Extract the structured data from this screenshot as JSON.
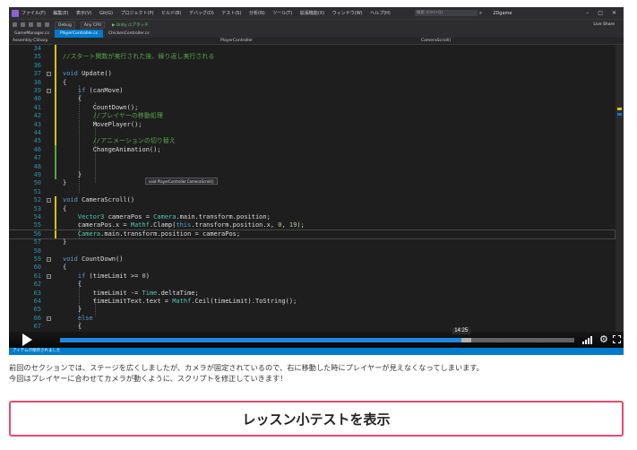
{
  "vs": {
    "menu": [
      "ファイル(F)",
      "編集(E)",
      "表示(V)",
      "Git(G)",
      "プロジェクト(P)",
      "ビルド(B)",
      "デバッグ(D)",
      "テスト(S)",
      "分析(N)",
      "ツール(T)",
      "拡張機能(X)",
      "ウィンドウ(W)",
      "ヘルプ(H)"
    ],
    "search_placeholder": "検索 (Ctrl+Q)",
    "project_name": "2Dgame",
    "toolbar": {
      "config": "Debug",
      "platform": "Any CPU",
      "run_label": "▶ Unity にアタッチ",
      "liveshare": "Live Share"
    },
    "tabs": [
      "GameManager.cs",
      "PlayerController.cs",
      "ChickenController.cs"
    ],
    "nav": {
      "assembly": "Assembly-CSharp",
      "class": "PlayerController",
      "member": "CameraScroll()"
    },
    "tooltip": "void PlayerController.CameraScroll()",
    "status": "アイテムが保存されました"
  },
  "code_lines": [
    {
      "n": "34",
      "text": ""
    },
    {
      "n": "35",
      "text": "//スタート関数が実行された後、繰り返し実行される"
    },
    {
      "n": "36",
      "text": ""
    },
    {
      "n": "37",
      "text": "void Update()"
    },
    {
      "n": "38",
      "text": "{"
    },
    {
      "n": "39",
      "text": "    if (canMove)"
    },
    {
      "n": "40",
      "text": "    {"
    },
    {
      "n": "41",
      "text": "        CountDown();"
    },
    {
      "n": "42",
      "text": "        //プレイヤーの移動処理"
    },
    {
      "n": "43",
      "text": "        MovePlayer();"
    },
    {
      "n": "44",
      "text": ""
    },
    {
      "n": "45",
      "text": "        //アニメーションの切り替え"
    },
    {
      "n": "46",
      "text": "        ChangeAnimation();"
    },
    {
      "n": "47",
      "text": ""
    },
    {
      "n": "48",
      "text": ""
    },
    {
      "n": "49",
      "text": "    }"
    },
    {
      "n": "50",
      "text": "}"
    },
    {
      "n": "51",
      "text": ""
    },
    {
      "n": "52",
      "text": "void CameraScroll()"
    },
    {
      "n": "53",
      "text": "{"
    },
    {
      "n": "54",
      "text": "    Vector3 cameraPos = Camera.main.transform.position;"
    },
    {
      "n": "55",
      "text": "    cameraPos.x = Mathf.Clamp(this.transform.position.x, 0, 19);"
    },
    {
      "n": "56",
      "text": "    Camera.main.transform.position = cameraPos;"
    },
    {
      "n": "57",
      "text": "}"
    },
    {
      "n": "58",
      "text": ""
    },
    {
      "n": "59",
      "text": "void CountDown()"
    },
    {
      "n": "60",
      "text": "{"
    },
    {
      "n": "61",
      "text": "    if (timeLimit >= 0)"
    },
    {
      "n": "62",
      "text": "    {"
    },
    {
      "n": "63",
      "text": "        timeLimit -= Time.deltaTime;"
    },
    {
      "n": "64",
      "text": "        timeLimitText.text = Mathf.Ceil(timeLimit).ToString();"
    },
    {
      "n": "65",
      "text": "    }"
    },
    {
      "n": "66",
      "text": "    else"
    },
    {
      "n": "67",
      "text": "    {"
    }
  ],
  "player": {
    "time_tooltip": "14:25",
    "progress_fraction": 0.78,
    "buffered_fraction": 0.8
  },
  "description": {
    "line1": "前回のセクションでは、ステージを広くしましたが、カメラが固定されているので、右に移動した時にプレイヤーが見えなくなってしまいます。",
    "line2": "今回はプレイヤーに合わせてカメラが動くように、スクリプトを修正していきます！"
  },
  "quiz_button": "レッスン小テストを表示",
  "colors": {
    "accent_border": "#e54a6e",
    "progress": "#1e88e5",
    "vs_blue": "#007acc"
  }
}
